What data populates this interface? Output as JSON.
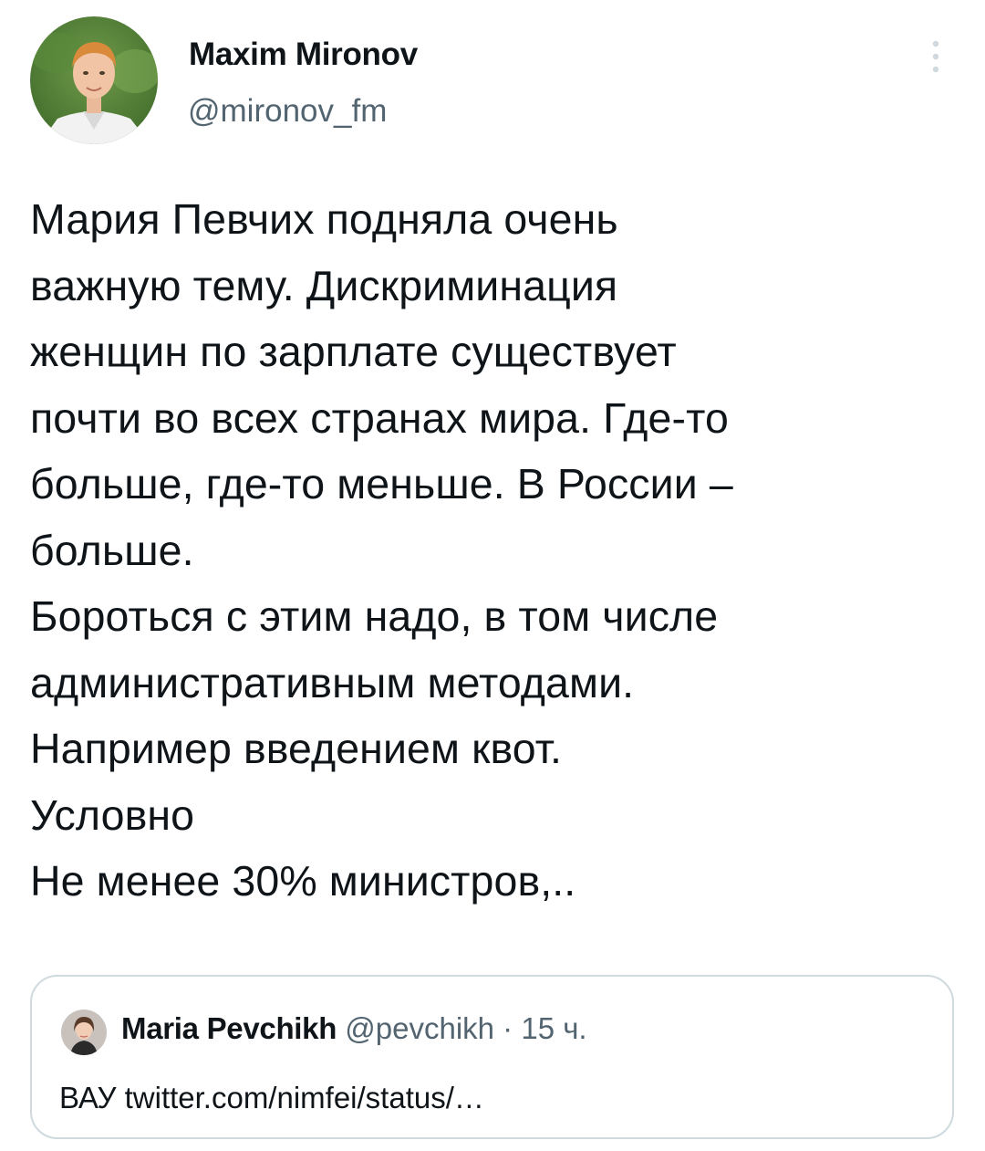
{
  "author": {
    "name": "Maxim Mironov",
    "handle": "@mironov_fm"
  },
  "icons": {
    "menu": "more-vertical-icon"
  },
  "tweet": {
    "lines": [
      "Мария Певчих подняла очень",
      "важную тему. Дискриминация",
      "женщин по зарплате существует",
      "почти во всех странах мира. Где-то",
      "больше, где-то меньше. В России –",
      "больше.",
      "Бороться с этим надо, в том числе",
      "административным методами.",
      "Например введением квот.",
      "Условно",
      "Не менее 30% министров,.."
    ]
  },
  "quoted": {
    "name": "Maria Pevchikh",
    "handle": "@pevchikh",
    "separator": " · ",
    "time": "15 ч.",
    "text": "ВАУ twitter.com/nimfei/status/…"
  },
  "colors": {
    "text": "#0f1419",
    "secondary": "#536471",
    "border": "#cfd9de"
  }
}
